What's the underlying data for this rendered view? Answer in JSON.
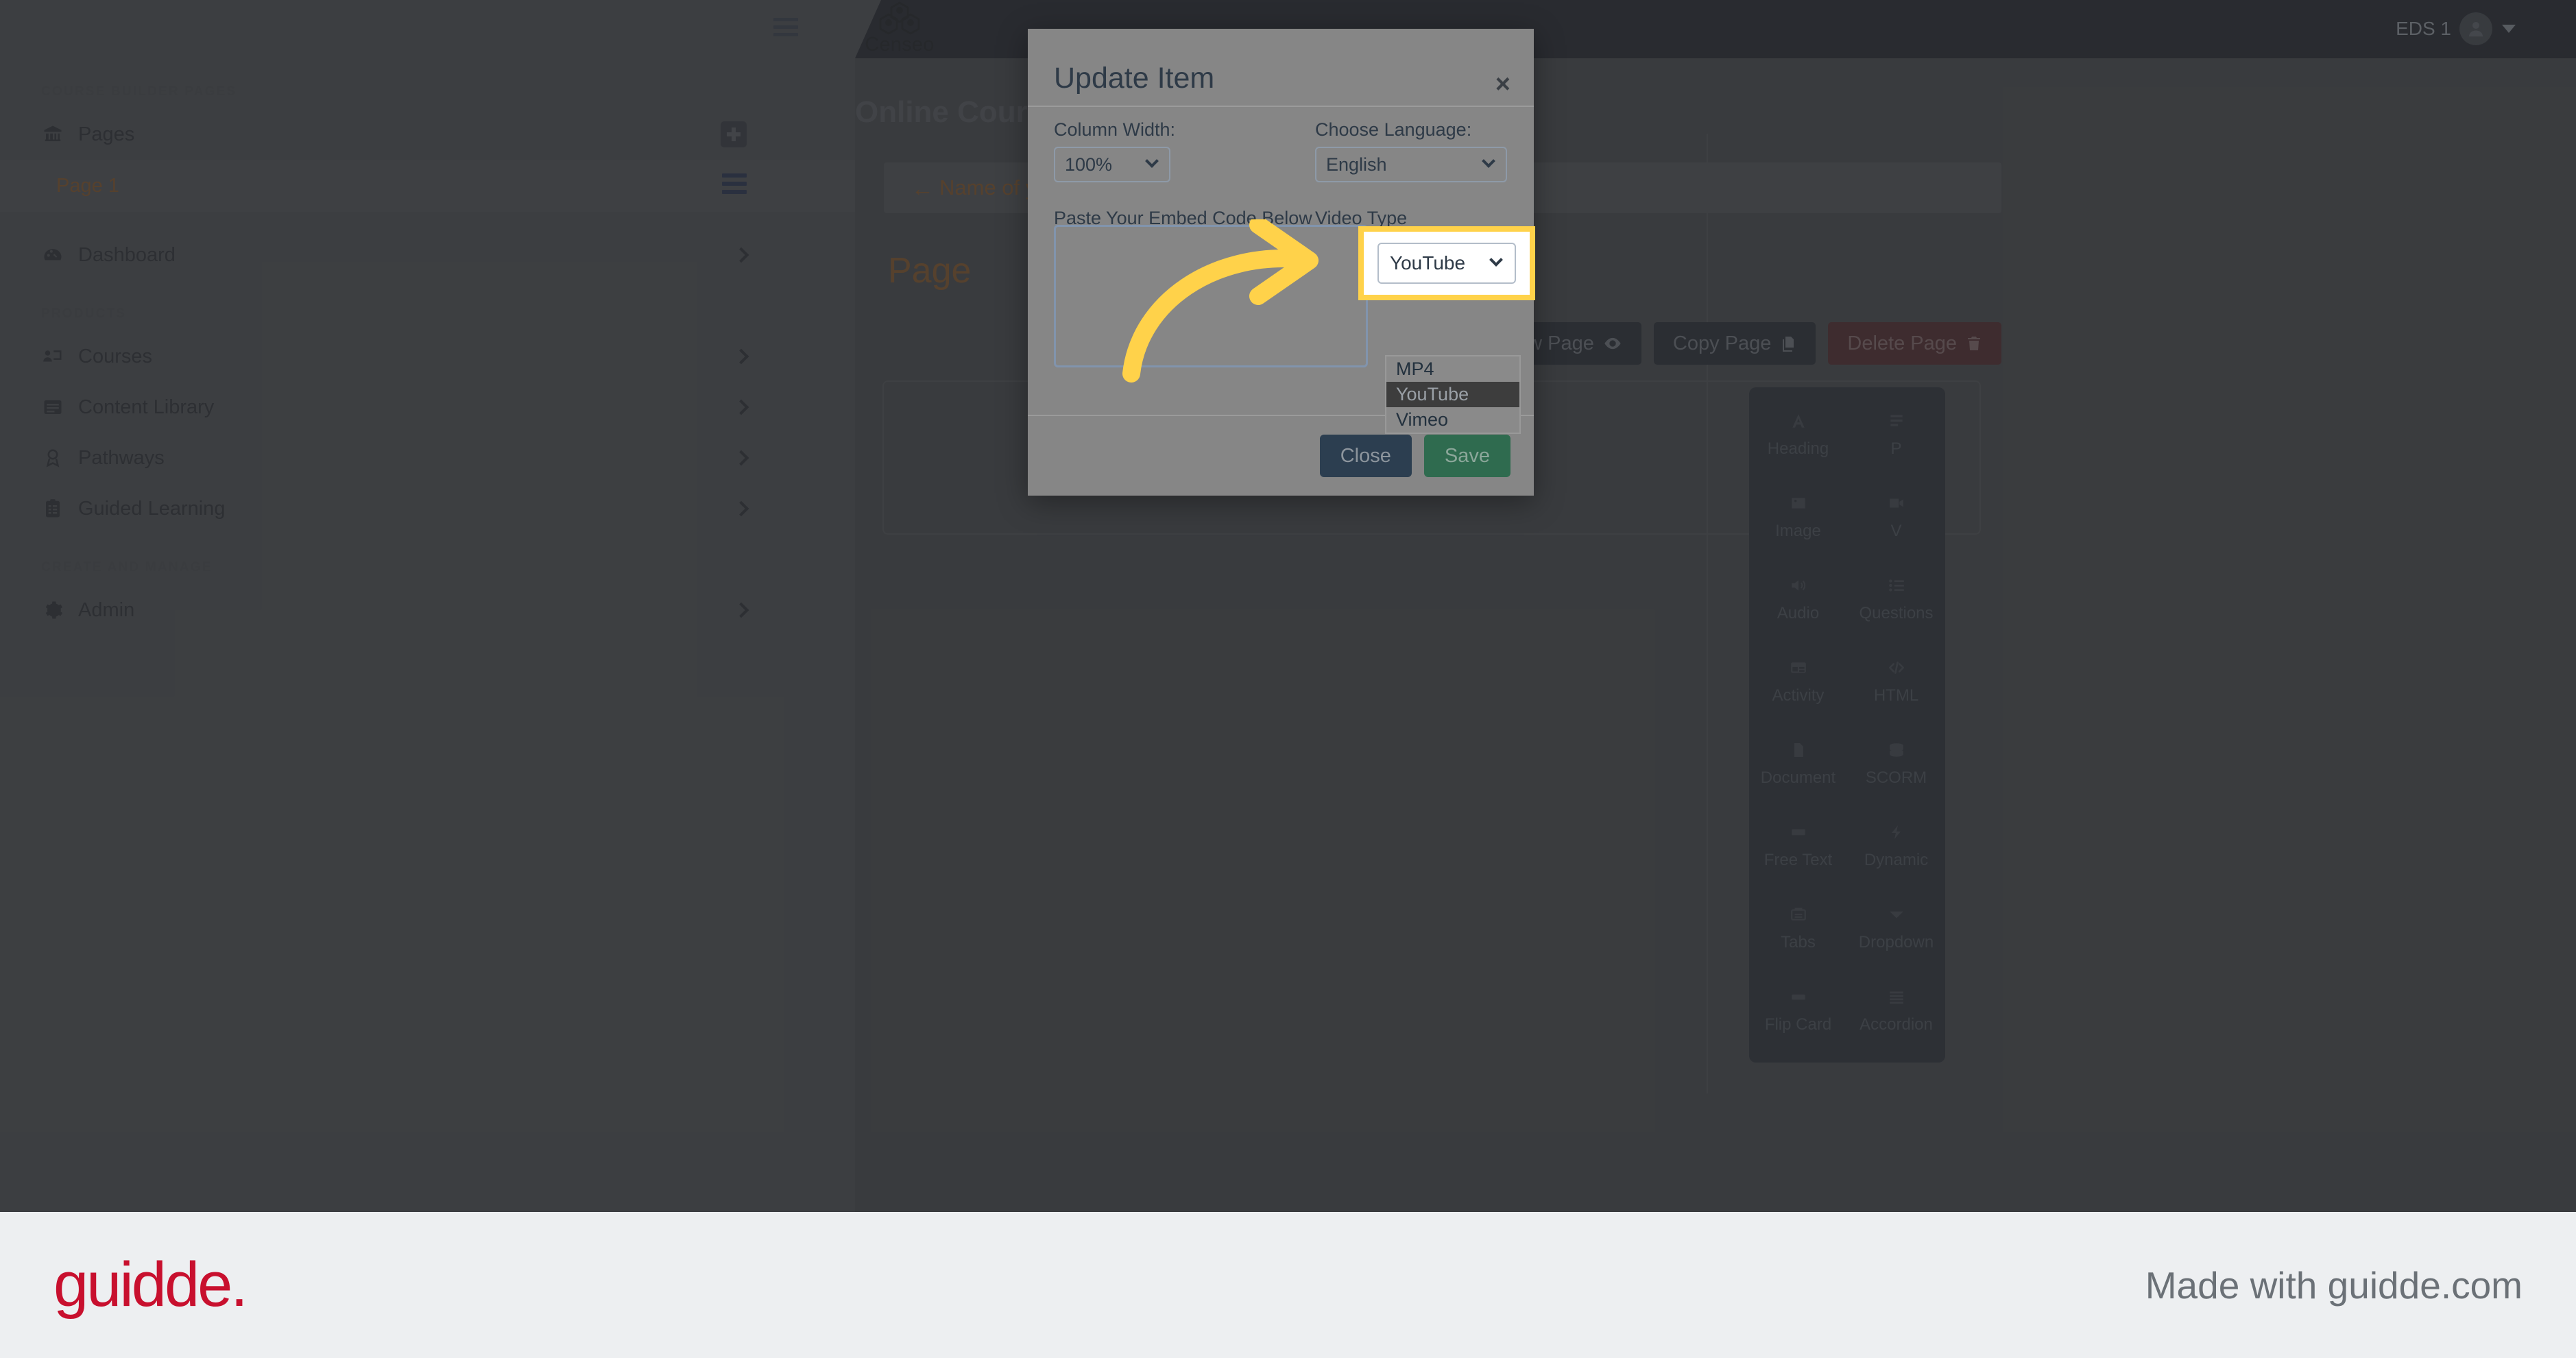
{
  "topbar": {
    "menu_icon": "hamburger-icon",
    "brand": "Censeo",
    "user_label": "EDS 1",
    "avatar_icon": "user-avatar-icon",
    "caret_icon": "chevron-down-icon"
  },
  "sidebar": {
    "sections": [
      {
        "label": "COURSE BUILDER PAGES",
        "items": [
          {
            "label": "Pages",
            "icon": "bank-icon",
            "action": "add-page-plus-icon",
            "chevron": false
          },
          {
            "label": "Page 1",
            "icon": "",
            "action": "drag-handle-icon",
            "chevron": false,
            "active": true
          },
          {
            "label": "Dashboard",
            "icon": "gauge-icon",
            "chevron": true
          }
        ]
      },
      {
        "label": "PRODUCTS",
        "items": [
          {
            "label": "Courses",
            "icon": "presentation-icon",
            "chevron": true
          },
          {
            "label": "Content Library",
            "icon": "book-icon",
            "chevron": true
          },
          {
            "label": "Pathways",
            "icon": "award-icon",
            "chevron": true
          },
          {
            "label": "Guided Learning",
            "icon": "clipboard-list-icon",
            "chevron": true
          }
        ]
      },
      {
        "label": "CREATE AND MANAGE",
        "items": [
          {
            "label": "Admin",
            "icon": "gear-icon",
            "chevron": true
          }
        ]
      }
    ]
  },
  "main": {
    "heading": "Online Course B",
    "course_bar": {
      "arrow": "←",
      "text": "Name of your c"
    },
    "page_title": "Page",
    "action_buttons": [
      {
        "label": "",
        "icon": "copy-icon",
        "style": "dark"
      },
      {
        "label": "View Page",
        "icon": "eye-icon",
        "style": "dark"
      },
      {
        "label": "Copy Page",
        "icon": "copy-icon",
        "style": "dark"
      },
      {
        "label": "Delete Page",
        "icon": "trash-icon",
        "style": "danger"
      }
    ]
  },
  "block_palette": [
    {
      "label": "Heading",
      "icon": "letter-a-icon"
    },
    {
      "label": "P",
      "icon": "paragraph-icon"
    },
    {
      "label": "Image",
      "icon": "image-icon"
    },
    {
      "label": "V",
      "icon": "video-icon"
    },
    {
      "label": "Audio",
      "icon": "speaker-icon"
    },
    {
      "label": "Questions",
      "icon": "list-icon"
    },
    {
      "label": "Activity",
      "icon": "layout-icon"
    },
    {
      "label": "HTML",
      "icon": "code-icon"
    },
    {
      "label": "Document",
      "icon": "file-icon"
    },
    {
      "label": "SCORM",
      "icon": "database-icon"
    },
    {
      "label": "Free Text",
      "icon": "rectangle-icon"
    },
    {
      "label": "Dynamic",
      "icon": "bolt-icon"
    },
    {
      "label": "Tabs",
      "icon": "tabs-icon"
    },
    {
      "label": "Dropdown",
      "icon": "caret-down-icon"
    },
    {
      "label": "Flip Card",
      "icon": "card-icon"
    },
    {
      "label": "Accordion",
      "icon": "stack-lines-icon"
    }
  ],
  "modal": {
    "title": "Update Item",
    "close_icon": "close-icon",
    "column_width": {
      "label": "Column Width:",
      "value": "100%"
    },
    "choose_language": {
      "label": "Choose Language:",
      "value": "English"
    },
    "embed": {
      "label": "Paste Your Embed Code Below",
      "value": "",
      "placeholder": ""
    },
    "video_type": {
      "label": "Video Type",
      "value": "YouTube",
      "options": [
        "MP4",
        "YouTube",
        "Vimeo"
      ],
      "selected": "YouTube"
    },
    "buttons": {
      "close": "Close",
      "save": "Save"
    }
  },
  "annotation": {
    "highlight_color": "#ffd24a",
    "arrow_icon": "curved-arrow-icon"
  },
  "footer": {
    "logo": "guidde.",
    "tagline": "Made with guidde.com",
    "logo_color": "#c8102e"
  }
}
